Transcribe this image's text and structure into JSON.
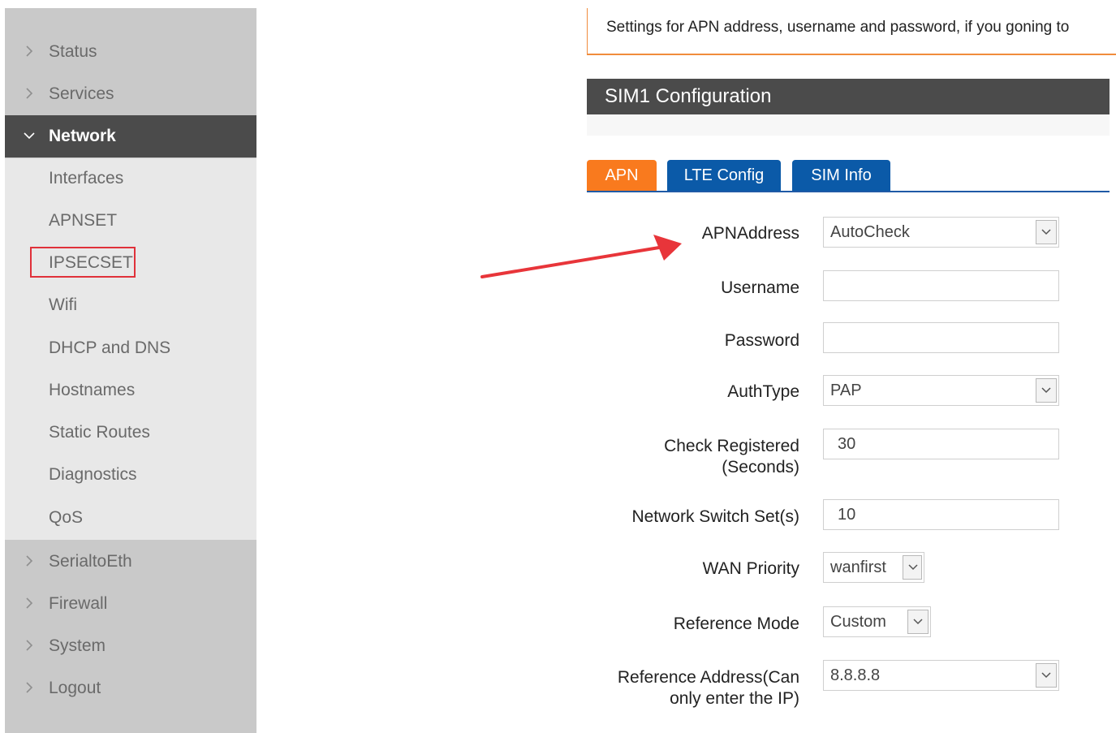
{
  "sidebar": {
    "items": [
      {
        "label": "Status"
      },
      {
        "label": "Services"
      },
      {
        "label": "Network"
      },
      {
        "label": "SerialtoEth"
      },
      {
        "label": "Firewall"
      },
      {
        "label": "System"
      },
      {
        "label": "Logout"
      }
    ],
    "network_sub": [
      {
        "label": "Interfaces"
      },
      {
        "label": "APNSET"
      },
      {
        "label": "IPSECSET"
      },
      {
        "label": "Wifi"
      },
      {
        "label": "DHCP and DNS"
      },
      {
        "label": "Hostnames"
      },
      {
        "label": "Static Routes"
      },
      {
        "label": "Diagnostics"
      },
      {
        "label": "QoS"
      }
    ]
  },
  "notice": "Settings for APN address, username and password, if you goning to",
  "section_title": "SIM1 Configuration",
  "tabs": [
    {
      "label": "APN"
    },
    {
      "label": "LTE Config"
    },
    {
      "label": "SIM Info"
    }
  ],
  "form": {
    "apn_address": {
      "label": "APNAddress",
      "value": "AutoCheck"
    },
    "username": {
      "label": "Username",
      "value": ""
    },
    "password": {
      "label": "Password",
      "value": ""
    },
    "auth_type": {
      "label": "AuthType",
      "value": "PAP"
    },
    "check_registered": {
      "label_line1": "Check Registered",
      "label_line2": "(Seconds)",
      "value": "30"
    },
    "network_switch": {
      "label": "Network Switch Set(s)",
      "value": "10"
    },
    "wan_priority": {
      "label": "WAN Priority",
      "value": "wanfirst"
    },
    "reference_mode": {
      "label": "Reference Mode",
      "value": "Custom"
    },
    "reference_address": {
      "label_line1": "Reference Address(Can",
      "label_line2": "only enter the IP)",
      "value": "8.8.8.8"
    }
  },
  "colors": {
    "active_tab": "#f97a1e",
    "tab": "#0b5aa8",
    "highlight": "#e0313a",
    "annotation_arrow": "#e8353a"
  }
}
